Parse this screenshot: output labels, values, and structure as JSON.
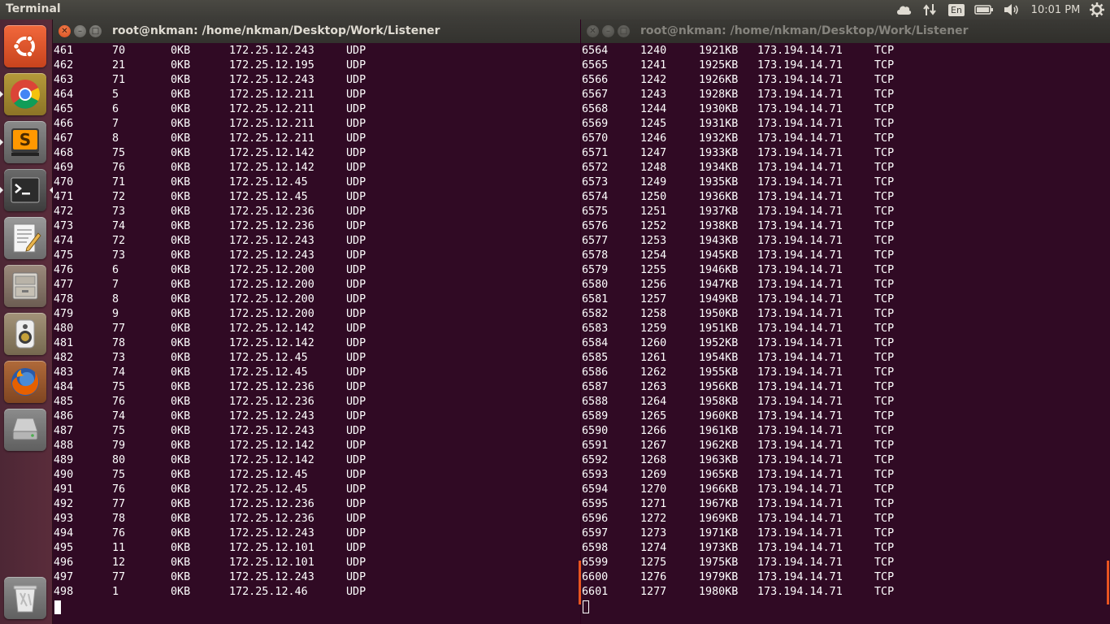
{
  "panel": {
    "title": "Terminal",
    "lang": "En",
    "clock": "10:01 PM"
  },
  "launcher": {
    "items": [
      {
        "name": "ubuntu-dash-icon"
      },
      {
        "name": "chrome-icon"
      },
      {
        "name": "sublime-text-icon"
      },
      {
        "name": "terminal-icon"
      },
      {
        "name": "text-editor-icon"
      },
      {
        "name": "file-manager-icon"
      },
      {
        "name": "rhythmbox-icon"
      },
      {
        "name": "firefox-icon"
      },
      {
        "name": "drive-icon"
      },
      {
        "name": "trash-icon"
      }
    ]
  },
  "terminals": [
    {
      "title": "root@nkman: /home/nkman/Desktop/Work/Listener",
      "rows": [
        [
          "461",
          "70",
          "0KB",
          "172.25.12.243",
          "UDP"
        ],
        [
          "462",
          "21",
          "0KB",
          "172.25.12.195",
          "UDP"
        ],
        [
          "463",
          "71",
          "0KB",
          "172.25.12.243",
          "UDP"
        ],
        [
          "464",
          "5",
          "0KB",
          "172.25.12.211",
          "UDP"
        ],
        [
          "465",
          "6",
          "0KB",
          "172.25.12.211",
          "UDP"
        ],
        [
          "466",
          "7",
          "0KB",
          "172.25.12.211",
          "UDP"
        ],
        [
          "467",
          "8",
          "0KB",
          "172.25.12.211",
          "UDP"
        ],
        [
          "468",
          "75",
          "0KB",
          "172.25.12.142",
          "UDP"
        ],
        [
          "469",
          "76",
          "0KB",
          "172.25.12.142",
          "UDP"
        ],
        [
          "470",
          "71",
          "0KB",
          "172.25.12.45",
          "UDP"
        ],
        [
          "471",
          "72",
          "0KB",
          "172.25.12.45",
          "UDP"
        ],
        [
          "472",
          "73",
          "0KB",
          "172.25.12.236",
          "UDP"
        ],
        [
          "473",
          "74",
          "0KB",
          "172.25.12.236",
          "UDP"
        ],
        [
          "474",
          "72",
          "0KB",
          "172.25.12.243",
          "UDP"
        ],
        [
          "475",
          "73",
          "0KB",
          "172.25.12.243",
          "UDP"
        ],
        [
          "476",
          "6",
          "0KB",
          "172.25.12.200",
          "UDP"
        ],
        [
          "477",
          "7",
          "0KB",
          "172.25.12.200",
          "UDP"
        ],
        [
          "478",
          "8",
          "0KB",
          "172.25.12.200",
          "UDP"
        ],
        [
          "479",
          "9",
          "0KB",
          "172.25.12.200",
          "UDP"
        ],
        [
          "480",
          "77",
          "0KB",
          "172.25.12.142",
          "UDP"
        ],
        [
          "481",
          "78",
          "0KB",
          "172.25.12.142",
          "UDP"
        ],
        [
          "482",
          "73",
          "0KB",
          "172.25.12.45",
          "UDP"
        ],
        [
          "483",
          "74",
          "0KB",
          "172.25.12.45",
          "UDP"
        ],
        [
          "484",
          "75",
          "0KB",
          "172.25.12.236",
          "UDP"
        ],
        [
          "485",
          "76",
          "0KB",
          "172.25.12.236",
          "UDP"
        ],
        [
          "486",
          "74",
          "0KB",
          "172.25.12.243",
          "UDP"
        ],
        [
          "487",
          "75",
          "0KB",
          "172.25.12.243",
          "UDP"
        ],
        [
          "488",
          "79",
          "0KB",
          "172.25.12.142",
          "UDP"
        ],
        [
          "489",
          "80",
          "0KB",
          "172.25.12.142",
          "UDP"
        ],
        [
          "490",
          "75",
          "0KB",
          "172.25.12.45",
          "UDP"
        ],
        [
          "491",
          "76",
          "0KB",
          "172.25.12.45",
          "UDP"
        ],
        [
          "492",
          "77",
          "0KB",
          "172.25.12.236",
          "UDP"
        ],
        [
          "493",
          "78",
          "0KB",
          "172.25.12.236",
          "UDP"
        ],
        [
          "494",
          "76",
          "0KB",
          "172.25.12.243",
          "UDP"
        ],
        [
          "495",
          "11",
          "0KB",
          "172.25.12.101",
          "UDP"
        ],
        [
          "496",
          "12",
          "0KB",
          "172.25.12.101",
          "UDP"
        ],
        [
          "497",
          "77",
          "0KB",
          "172.25.12.243",
          "UDP"
        ],
        [
          "498",
          "1",
          "0KB",
          "172.25.12.46",
          "UDP"
        ]
      ]
    },
    {
      "title": "root@nkman: /home/nkman/Desktop/Work/Listener",
      "rows": [
        [
          "6564",
          "1240",
          "1921KB",
          "173.194.14.71",
          "TCP"
        ],
        [
          "6565",
          "1241",
          "1925KB",
          "173.194.14.71",
          "TCP"
        ],
        [
          "6566",
          "1242",
          "1926KB",
          "173.194.14.71",
          "TCP"
        ],
        [
          "6567",
          "1243",
          "1928KB",
          "173.194.14.71",
          "TCP"
        ],
        [
          "6568",
          "1244",
          "1930KB",
          "173.194.14.71",
          "TCP"
        ],
        [
          "6569",
          "1245",
          "1931KB",
          "173.194.14.71",
          "TCP"
        ],
        [
          "6570",
          "1246",
          "1932KB",
          "173.194.14.71",
          "TCP"
        ],
        [
          "6571",
          "1247",
          "1933KB",
          "173.194.14.71",
          "TCP"
        ],
        [
          "6572",
          "1248",
          "1934KB",
          "173.194.14.71",
          "TCP"
        ],
        [
          "6573",
          "1249",
          "1935KB",
          "173.194.14.71",
          "TCP"
        ],
        [
          "6574",
          "1250",
          "1936KB",
          "173.194.14.71",
          "TCP"
        ],
        [
          "6575",
          "1251",
          "1937KB",
          "173.194.14.71",
          "TCP"
        ],
        [
          "6576",
          "1252",
          "1938KB",
          "173.194.14.71",
          "TCP"
        ],
        [
          "6577",
          "1253",
          "1943KB",
          "173.194.14.71",
          "TCP"
        ],
        [
          "6578",
          "1254",
          "1945KB",
          "173.194.14.71",
          "TCP"
        ],
        [
          "6579",
          "1255",
          "1946KB",
          "173.194.14.71",
          "TCP"
        ],
        [
          "6580",
          "1256",
          "1947KB",
          "173.194.14.71",
          "TCP"
        ],
        [
          "6581",
          "1257",
          "1949KB",
          "173.194.14.71",
          "TCP"
        ],
        [
          "6582",
          "1258",
          "1950KB",
          "173.194.14.71",
          "TCP"
        ],
        [
          "6583",
          "1259",
          "1951KB",
          "173.194.14.71",
          "TCP"
        ],
        [
          "6584",
          "1260",
          "1952KB",
          "173.194.14.71",
          "TCP"
        ],
        [
          "6585",
          "1261",
          "1954KB",
          "173.194.14.71",
          "TCP"
        ],
        [
          "6586",
          "1262",
          "1955KB",
          "173.194.14.71",
          "TCP"
        ],
        [
          "6587",
          "1263",
          "1956KB",
          "173.194.14.71",
          "TCP"
        ],
        [
          "6588",
          "1264",
          "1958KB",
          "173.194.14.71",
          "TCP"
        ],
        [
          "6589",
          "1265",
          "1960KB",
          "173.194.14.71",
          "TCP"
        ],
        [
          "6590",
          "1266",
          "1961KB",
          "173.194.14.71",
          "TCP"
        ],
        [
          "6591",
          "1267",
          "1962KB",
          "173.194.14.71",
          "TCP"
        ],
        [
          "6592",
          "1268",
          "1963KB",
          "173.194.14.71",
          "TCP"
        ],
        [
          "6593",
          "1269",
          "1965KB",
          "173.194.14.71",
          "TCP"
        ],
        [
          "6594",
          "1270",
          "1966KB",
          "173.194.14.71",
          "TCP"
        ],
        [
          "6595",
          "1271",
          "1967KB",
          "173.194.14.71",
          "TCP"
        ],
        [
          "6596",
          "1272",
          "1969KB",
          "173.194.14.71",
          "TCP"
        ],
        [
          "6597",
          "1273",
          "1971KB",
          "173.194.14.71",
          "TCP"
        ],
        [
          "6598",
          "1274",
          "1973KB",
          "173.194.14.71",
          "TCP"
        ],
        [
          "6599",
          "1275",
          "1975KB",
          "173.194.14.71",
          "TCP"
        ],
        [
          "6600",
          "1276",
          "1979KB",
          "173.194.14.71",
          "TCP"
        ],
        [
          "6601",
          "1277",
          "1980KB",
          "173.194.14.71",
          "TCP"
        ]
      ]
    }
  ]
}
